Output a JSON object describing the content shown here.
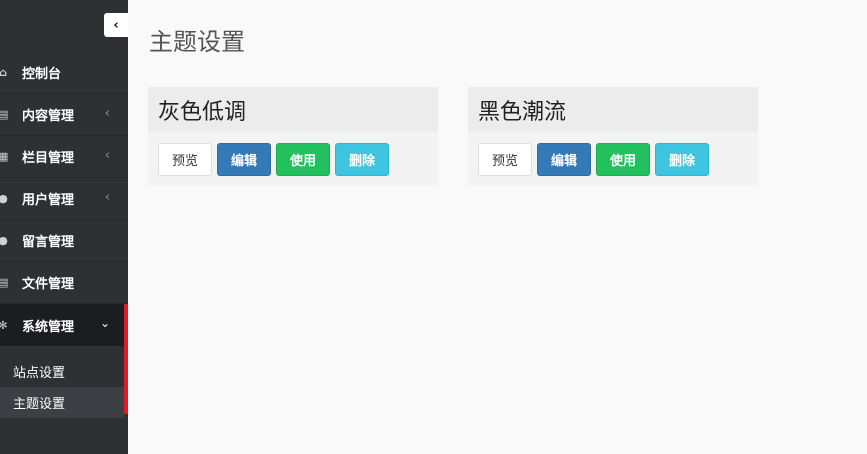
{
  "sidebar": {
    "collapse_icon": "‹",
    "items": [
      {
        "label": "控制台",
        "icon": "home-icon",
        "glyph": "⌂",
        "arrow": ""
      },
      {
        "label": "内容管理",
        "icon": "file-icon",
        "glyph": "▤",
        "arrow": "‹"
      },
      {
        "label": "栏目管理",
        "icon": "columns-icon",
        "glyph": "▦",
        "arrow": "‹"
      },
      {
        "label": "用户管理",
        "icon": "user-icon",
        "glyph": "●",
        "arrow": "‹"
      },
      {
        "label": "留言管理",
        "icon": "comment-icon",
        "glyph": "●",
        "arrow": ""
      },
      {
        "label": "文件管理",
        "icon": "document-icon",
        "glyph": "▤",
        "arrow": ""
      },
      {
        "label": "系统管理",
        "icon": "gears-icon",
        "glyph": "✻",
        "arrow": "⌄"
      }
    ],
    "submenu": [
      {
        "label": "站点设置"
      },
      {
        "label": "主题设置"
      }
    ]
  },
  "main": {
    "title": "主题设置",
    "themes": [
      {
        "name": "灰色低调",
        "buttons": {
          "preview": "预览",
          "edit": "编辑",
          "use": "使用",
          "delete": "删除"
        }
      },
      {
        "name": "黑色潮流",
        "buttons": {
          "preview": "预览",
          "edit": "编辑",
          "use": "使用",
          "delete": "删除"
        }
      }
    ]
  },
  "colors": {
    "sidebar_bg": "#2f3034",
    "active_marker": "#e01b24",
    "primary": "#337ab7",
    "success": "#22c15e",
    "info": "#3cc4e0"
  }
}
